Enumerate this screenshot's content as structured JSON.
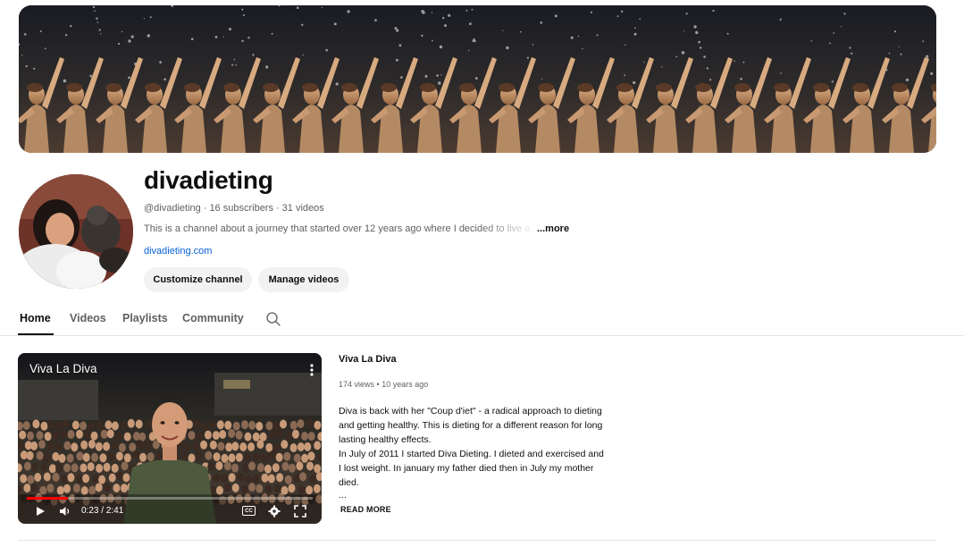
{
  "banner": {
    "description_icon": "banner-image"
  },
  "channel": {
    "name": "divadieting",
    "handle": "@divadieting",
    "subscribers": "16 subscribers",
    "videos": "31 videos",
    "separator": "·",
    "description": "This is a channel about a journey that started over 12 years ago where I decided to live a",
    "more_label": "...more",
    "link": "divadieting.com",
    "customize_label": "Customize channel",
    "manage_label": "Manage videos"
  },
  "tabs": [
    {
      "label": "Home",
      "active": true
    },
    {
      "label": "Videos",
      "active": false
    },
    {
      "label": "Playlists",
      "active": false
    },
    {
      "label": "Community",
      "active": false
    }
  ],
  "tab_search_icon": "search-icon",
  "featured": {
    "player_title": "Viva La Diva",
    "time_current": "0:23",
    "time_total": "2:41",
    "time_display": "0:23 / 2:41",
    "progress": 0.143,
    "title": "Viva La Diva",
    "views": "174 views",
    "age": "10 years ago",
    "meta_separator": "•",
    "description_lines": [
      "Diva is back with her \"Coup d'iet\" - a radical approach to dieting",
      "and getting healthy. This is dieting for a different reason for long",
      "lasting healthy effects.",
      "In July of 2011 I started Diva Dieting. I dieted and exercised and",
      "I lost weight. In january my father died then in July my mother",
      "died.",
      "..."
    ],
    "read_more_label": "READ MORE",
    "cc_label": "CC"
  },
  "colors": {
    "accent_link": "#065fd4",
    "progress": "#ff0000",
    "pill_bg": "#f2f2f2",
    "muted_text": "#606060"
  }
}
